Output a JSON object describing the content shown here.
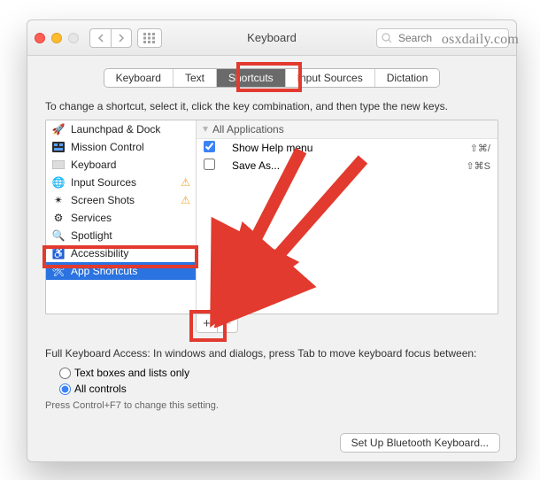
{
  "window": {
    "title": "Keyboard"
  },
  "search": {
    "placeholder": "Search"
  },
  "watermark": "osxdaily.com",
  "tabs": [
    {
      "label": "Keyboard",
      "selected": false
    },
    {
      "label": "Text",
      "selected": false
    },
    {
      "label": "Shortcuts",
      "selected": true
    },
    {
      "label": "Input Sources",
      "selected": false
    },
    {
      "label": "Dictation",
      "selected": false
    }
  ],
  "instructions": "To change a shortcut, select it, click the key combination, and then type the new keys.",
  "categories": [
    {
      "label": "Launchpad & Dock",
      "icon": "🚀",
      "warn": false
    },
    {
      "label": "Mission Control",
      "icon": "mc",
      "warn": false
    },
    {
      "label": "Keyboard",
      "icon": "kb",
      "warn": false
    },
    {
      "label": "Input Sources",
      "icon": "🌐",
      "warn": true
    },
    {
      "label": "Screen Shots",
      "icon": "✂",
      "warn": true
    },
    {
      "label": "Services",
      "icon": "⚙",
      "warn": false
    },
    {
      "label": "Spotlight",
      "icon": "🔍",
      "warn": false
    },
    {
      "label": "Accessibility",
      "icon": "♿",
      "warn": false
    },
    {
      "label": "App Shortcuts",
      "icon": "🛠",
      "warn": false,
      "selected": true
    }
  ],
  "group": {
    "header": "All Applications"
  },
  "shortcuts": [
    {
      "checked": true,
      "label": "Show Help menu",
      "keys": "⇧⌘/"
    },
    {
      "checked": false,
      "label": "Save As...",
      "keys": "⇧⌘S"
    }
  ],
  "fka": {
    "text": "Full Keyboard Access: In windows and dialogs, press Tab to move keyboard focus between:",
    "opt1": "Text boxes and lists only",
    "opt2": "All controls",
    "hint": "Press Control+F7 to change this setting."
  },
  "footer": {
    "bluetooth": "Set Up Bluetooth Keyboard..."
  }
}
